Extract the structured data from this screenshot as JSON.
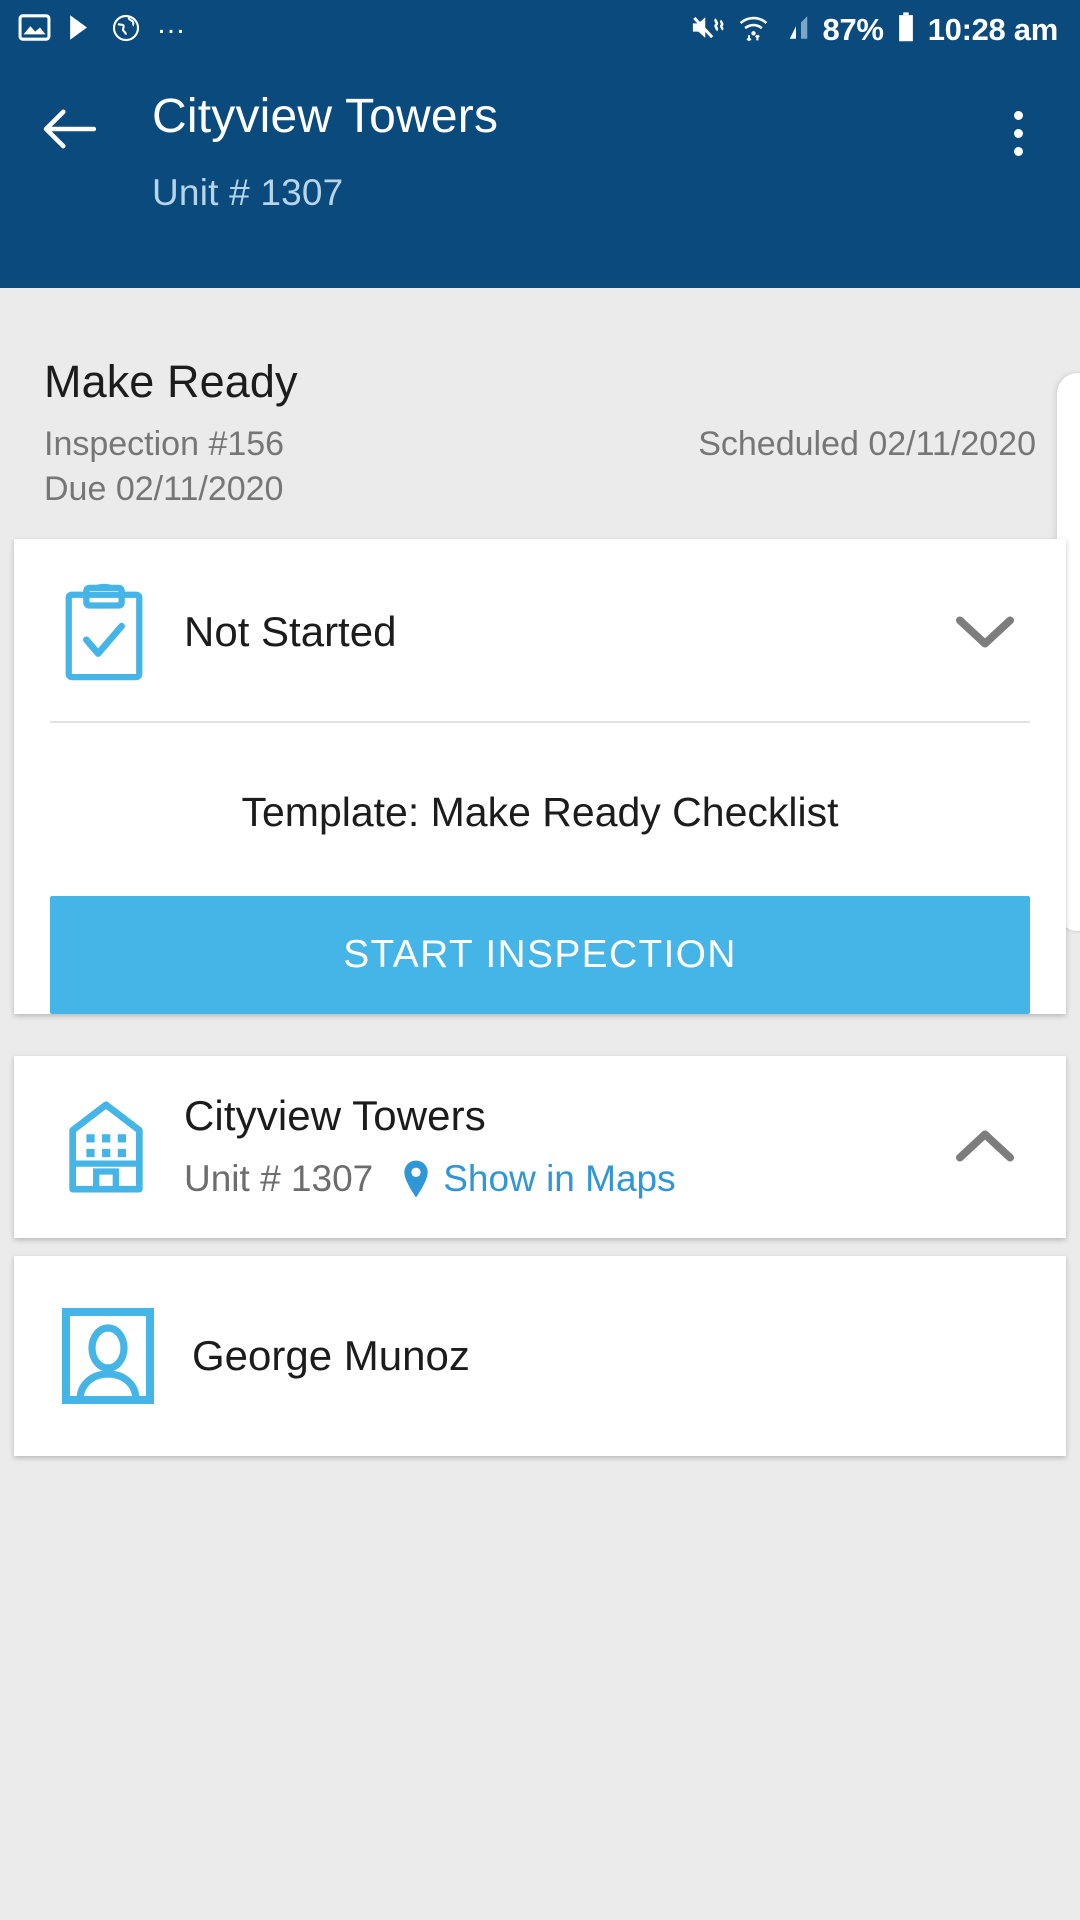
{
  "status_bar": {
    "left_icons": [
      "image-icon",
      "play-store-icon",
      "globe-sync-icon",
      "more-notifications-icon"
    ],
    "right_icons": [
      "volume-mute-vibrate-icon",
      "wifi-data-icon",
      "cellular-signal-icon",
      "battery-icon"
    ],
    "battery_percent": "87%",
    "time": "10:28 am"
  },
  "app_bar": {
    "back_icon": "arrow-left-icon",
    "title": "Cityview Towers",
    "subtitle": "Unit # 1307",
    "overflow_icon": "more-vertical-icon"
  },
  "inspection": {
    "title": "Make Ready",
    "number": "Inspection #156",
    "scheduled": "Scheduled 02/11/2020",
    "due": "Due 02/11/2020"
  },
  "status_card": {
    "icon": "clipboard-check-icon",
    "status": "Not Started",
    "expand_icon": "chevron-down-icon",
    "template": "Template: Make Ready Checklist",
    "start_label": "START INSPECTION"
  },
  "property_card": {
    "icon": "building-icon",
    "name": "Cityview Towers",
    "unit": "Unit # 1307",
    "pin_icon": "map-pin-icon",
    "maps_link": "Show in Maps",
    "collapse_icon": "chevron-up-icon"
  },
  "person_card": {
    "icon": "contact-card-icon",
    "name": "George Munoz"
  },
  "colors": {
    "header_blue": "#0a4a7d",
    "accent_blue": "#45b4e6",
    "link_blue": "#2f96d8",
    "page_bg": "#ebebeb",
    "card_bg": "#ffffff"
  }
}
